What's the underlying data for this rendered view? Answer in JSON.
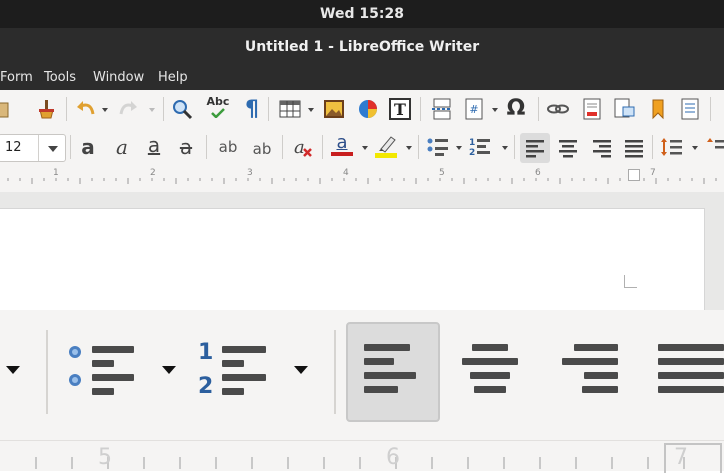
{
  "system": {
    "clock": "Wed 15:28"
  },
  "window": {
    "title": "Untitled 1 - LibreOffice Writer"
  },
  "menu": {
    "items": [
      "Form",
      "Tools",
      "Window",
      "Help"
    ]
  },
  "format": {
    "font_size": "12",
    "spell_label": "Abc",
    "pilcrow": "¶",
    "omega": "Ω",
    "bold_glyph": "a",
    "superscript_label": "ab",
    "subscript_label": "ab",
    "numbered_list_1": "1",
    "numbered_list_2": "2"
  },
  "ruler": {
    "labels": [
      "1",
      "2",
      "3",
      "4",
      "5",
      "6",
      "7"
    ]
  },
  "zoom_ruler": {
    "labels": [
      "5",
      "6",
      "7"
    ]
  },
  "colors": {
    "font_color_accent": "#c81e1e",
    "highlight_accent": "#f2e800",
    "list_bullet_blue": "#4a7fc1",
    "list_number_blue": "#2c5f9e",
    "active_button": "#dcdcdc"
  },
  "icons": [
    "paint-brush-icon",
    "undo-icon",
    "redo-icon",
    "find-replace-icon",
    "spellcheck-icon",
    "formatting-marks-icon",
    "insert-table-icon",
    "insert-image-icon",
    "insert-chart-icon",
    "insert-textbox-icon",
    "page-break-icon",
    "insert-field-icon",
    "special-character-icon",
    "hyperlink-icon",
    "footnote-icon",
    "comment-icon",
    "bookmark-icon",
    "cross-reference-icon",
    "bold-icon",
    "italic-icon",
    "underline-icon",
    "strikethrough-icon",
    "superscript-icon",
    "subscript-icon",
    "clear-formatting-icon",
    "font-color-icon",
    "highlight-icon",
    "bullet-list-icon",
    "numbered-list-icon",
    "align-left-icon",
    "align-center-icon",
    "align-right-icon",
    "justify-icon",
    "line-spacing-icon"
  ]
}
